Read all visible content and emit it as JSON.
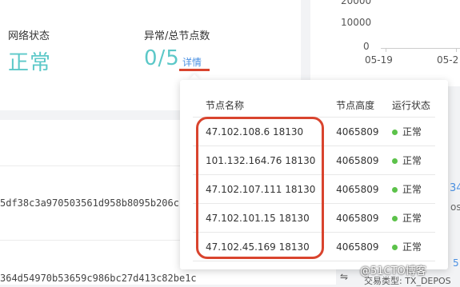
{
  "stats": {
    "network_status_label": "网络状态",
    "network_status_value": "正常",
    "abnormal_nodes_label": "异常/总节点数",
    "abnormal_nodes_value": "0/5",
    "detail_link": "详情"
  },
  "chart_data": {
    "type": "line",
    "yticks": [
      "20000",
      "10000",
      "0"
    ],
    "xticks": [
      "05-19",
      "05-2"
    ],
    "title": "",
    "xlabel": "",
    "ylabel": ""
  },
  "transactions": {
    "hash_1": "5df38c3a970503561d958b8095b206c",
    "hash_2": "364d54970b53659c986bc27d413c82be1c",
    "right_fragment_1": "34",
    "right_fragment_2": "os",
    "right_fragment_3": "5",
    "tx_type_label": "交易类型: TX_DEPOS"
  },
  "popover": {
    "headers": {
      "name": "节点名称",
      "height": "节点高度",
      "status": "运行状态"
    },
    "nodes": [
      {
        "name": "47.102.108.6 18130",
        "height": "4065809",
        "status": "正常"
      },
      {
        "name": "101.132.164.76 18130",
        "height": "4065809",
        "status": "正常"
      },
      {
        "name": "47.102.107.111 18130",
        "height": "4065809",
        "status": "正常"
      },
      {
        "name": "47.102.101.15 18130",
        "height": "4065809",
        "status": "正常"
      },
      {
        "name": "47.102.45.169 18130",
        "height": "4065809",
        "status": "正常"
      }
    ],
    "status_color": "#5cc24a"
  },
  "watermark": "@51CTO博客",
  "colors": {
    "accent": "#5cc8c8",
    "link": "#4a90e2",
    "annotation": "#d9442e"
  }
}
